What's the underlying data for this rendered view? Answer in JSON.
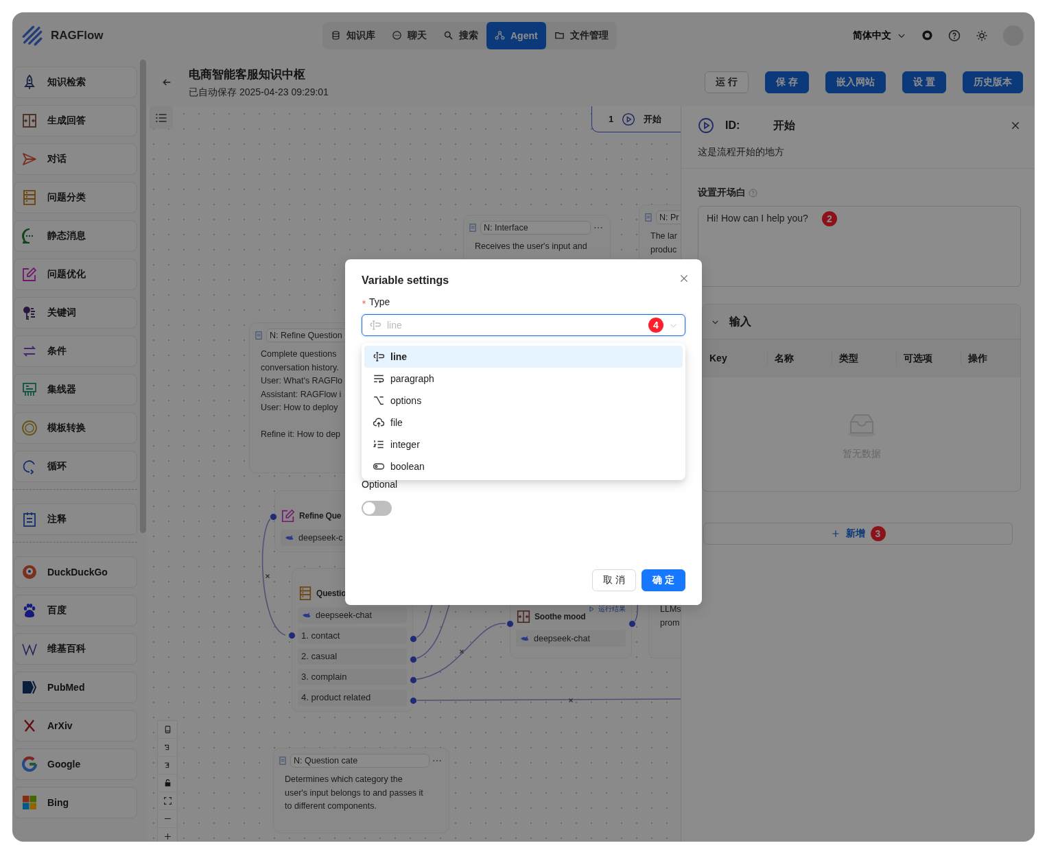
{
  "header": {
    "logo": "RAGFlow",
    "nav": [
      {
        "label": "知识库",
        "selected": false
      },
      {
        "label": "聊天",
        "selected": false
      },
      {
        "label": "搜索",
        "selected": false
      },
      {
        "label": "Agent",
        "selected": true
      },
      {
        "label": "文件管理",
        "selected": false
      }
    ],
    "language": "简体中文"
  },
  "toolbar": {
    "title": "电商智能客服知识中枢",
    "saved": "已自动保存 2025-04-23 09:29:01",
    "buttons": [
      {
        "label": "运 行",
        "kind": "default"
      },
      {
        "label": "保 存",
        "kind": "primary"
      },
      {
        "label": "嵌入网站",
        "kind": "primary"
      },
      {
        "label": "设 置",
        "kind": "primary"
      },
      {
        "label": "历史版本",
        "kind": "primary"
      }
    ]
  },
  "sidebar": {
    "sections": [
      {
        "items": [
          {
            "label": "知识检索"
          },
          {
            "label": "生成回答"
          },
          {
            "label": "对话"
          },
          {
            "label": "问题分类"
          },
          {
            "label": "静态消息"
          },
          {
            "label": "问题优化"
          },
          {
            "label": "关键词"
          },
          {
            "label": "条件"
          },
          {
            "label": "集线器"
          },
          {
            "label": "模板转换"
          },
          {
            "label": "循环"
          }
        ]
      },
      {
        "items": [
          {
            "label": "注释"
          }
        ]
      },
      {
        "items": [
          {
            "label": "DuckDuckGo"
          },
          {
            "label": "百度"
          },
          {
            "label": "维基百科"
          },
          {
            "label": "PubMed"
          },
          {
            "label": "ArXiv"
          },
          {
            "label": "Google"
          },
          {
            "label": "Bing"
          }
        ]
      }
    ]
  },
  "canvas": {
    "start_node": {
      "label": "开始",
      "marker": "1"
    },
    "nodes": [
      {
        "kind": "note",
        "title": "N: Interface",
        "paragraphs": [
          [
            "Receives the user's input and"
          ]
        ]
      },
      {
        "kind": "note",
        "title": "N: Pr",
        "paragraphs": [
          [
            "The lar",
            "produc"
          ]
        ]
      },
      {
        "kind": "note",
        "title": "N: Refine Question",
        "paragraphs": [
          [
            "Complete questions",
            "conversation history.",
            "User: What's RAGFlo",
            "Assistant: RAGFlow i",
            "User: How to deploy"
          ],
          [
            "Refine it: How to dep"
          ]
        ]
      },
      {
        "kind": "operator",
        "title": "Refine Que",
        "model": "deepseek-c"
      },
      {
        "kind": "operator",
        "title": "Questio",
        "model": "deepseek-chat",
        "outputs": [
          "1. contact",
          "2. casual",
          "3. complain",
          "4. product related"
        ]
      },
      {
        "kind": "operator",
        "title": "Soothe mood",
        "model": "deepseek-chat",
        "run_link": "运行结果"
      },
      {
        "kind": "fragment",
        "paragraphs": [
          [
            "LLMs",
            "prom"
          ]
        ]
      },
      {
        "kind": "note",
        "title": "N: Question cate",
        "paragraphs": [
          [
            "Determines which category the",
            "user's input belongs to and passes it",
            "to different components."
          ]
        ]
      }
    ]
  },
  "panel": {
    "id_label": "ID:",
    "title": "开始",
    "description": "这是流程开始的地方",
    "greeting": {
      "label": "设置开场白",
      "value": "Hi! How can I help you?",
      "marker": "2"
    },
    "inputs": {
      "title": "输入",
      "expanded": true,
      "columns": [
        "Key",
        "名称",
        "类型",
        "可选项",
        "操作"
      ],
      "empty": "暂无数据"
    },
    "add_button": {
      "label": "新增",
      "marker": "3"
    }
  },
  "modal": {
    "title": "Variable settings",
    "type_label": "Type",
    "required": true,
    "select": {
      "value": "line",
      "open": true,
      "marker": "4"
    },
    "options": [
      {
        "label": "line",
        "selected": true
      },
      {
        "label": "paragraph",
        "selected": false
      },
      {
        "label": "options",
        "selected": false
      },
      {
        "label": "file",
        "selected": false
      },
      {
        "label": "integer",
        "selected": false
      },
      {
        "label": "boolean",
        "selected": false
      }
    ],
    "optional_label": "Optional",
    "optional": {
      "on": false
    },
    "buttons": [
      {
        "label": "取 消",
        "kind": "default"
      },
      {
        "label": "确 定",
        "kind": "primary"
      }
    ]
  }
}
